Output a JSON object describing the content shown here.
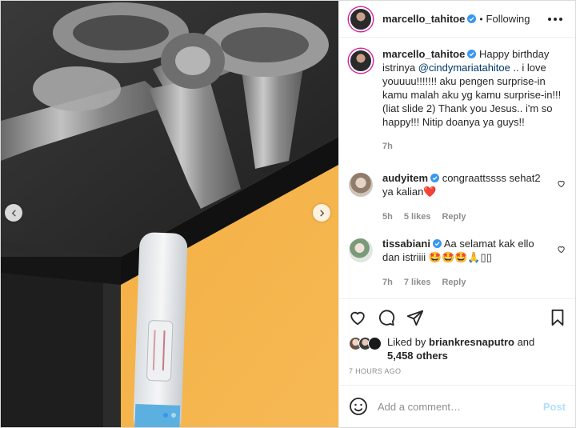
{
  "post": {
    "author": "marcello_tahitoe",
    "follow_status": "Following",
    "caption": {
      "username": "marcello_tahitoe",
      "text_before": "Happy birthday istrinya ",
      "mention": "@cindymariatahitoe",
      "text_after": " .. i love youuuu!!!!!!! aku pengen surprise-in kamu malah aku yg kamu surprise-in!!! (liat slide 2) Thank you Jesus.. i'm so happy!!! Nitip doanya ya guys!!",
      "time": "7h"
    },
    "comments": [
      {
        "username": "audyitem",
        "text": "congraattssss sehat2 ya kalian",
        "emoji": "❤️",
        "time": "5h",
        "likes": "5 likes",
        "reply": "Reply"
      },
      {
        "username": "tissabiani",
        "text": "Aa selamat kak ello dan istriiii",
        "emoji": "🤩🤩🤩🙏▯▯",
        "time": "7h",
        "likes": "7 likes",
        "reply": "Reply"
      }
    ],
    "likes": {
      "prefix": "Liked by ",
      "user": "briankresnaputro",
      "middle": " and",
      "others": "5,458 others"
    },
    "timestamp": "7 HOURS AGO",
    "add_comment": {
      "placeholder": "Add a comment…",
      "post_label": "Post"
    },
    "carousel": {
      "slide_count": 2,
      "active_slide": 1
    }
  },
  "icons": {
    "header_more": "more-horizontal-icon",
    "like": "heart-icon",
    "comment": "comment-icon",
    "share": "share-icon",
    "save": "bookmark-icon",
    "emoji": "smiley-icon",
    "verified": "verified-badge-icon",
    "prev": "chevron-left-icon",
    "next": "chevron-right-icon"
  },
  "colors": {
    "verified_blue": "#3897f0",
    "mention": "#00376b",
    "muted": "#8e8e8e",
    "post_disabled": "#b2dffc",
    "heart_emoji": "#e0245e"
  }
}
